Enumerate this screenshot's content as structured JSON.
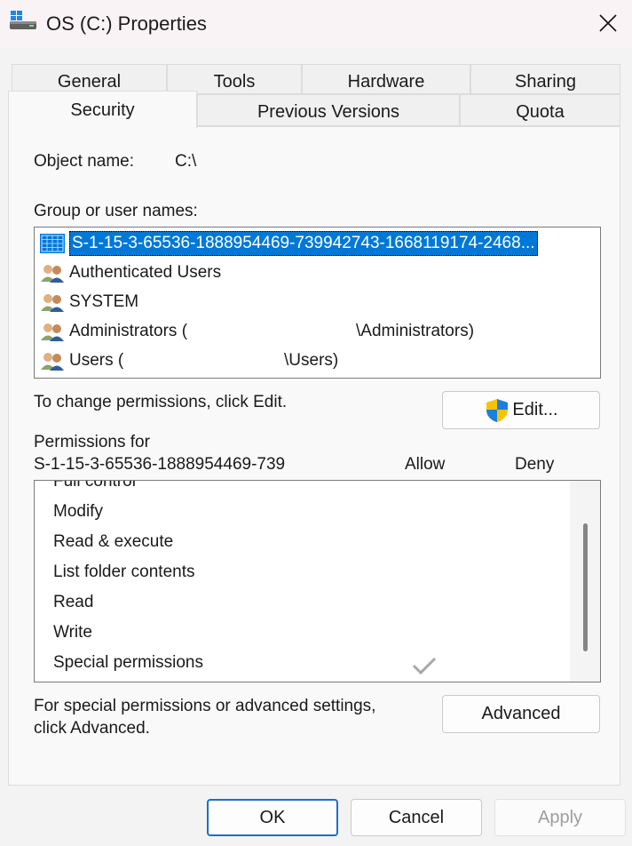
{
  "window": {
    "title": "OS (C:) Properties",
    "icon": "drive-icon",
    "close_icon": "close-icon"
  },
  "tabs_row1": [
    "General",
    "Tools",
    "Hardware",
    "Sharing"
  ],
  "tabs_row2": [
    "Security",
    "Previous Versions",
    "Quota"
  ],
  "active_tab": "Security",
  "object": {
    "label": "Object name:",
    "value": "C:\\"
  },
  "group": {
    "label": "Group or user names:",
    "users": [
      {
        "name": "S-1-15-3-65536-1888954469-739942743-1668119174-2468...",
        "icon": "package-icon",
        "selected": true
      },
      {
        "name": "Authenticated Users",
        "icon": "users-icon"
      },
      {
        "name": "SYSTEM",
        "icon": "users-icon"
      },
      {
        "name": "Administrators (",
        "suffix": "\\Administrators)",
        "icon": "users-icon"
      },
      {
        "name": "Users (",
        "suffix": "\\Users)",
        "icon": "users-icon"
      }
    ]
  },
  "change_hint": "To change permissions, click Edit.",
  "edit_button": "Edit...",
  "permissions": {
    "label_line1": "Permissions for",
    "label_line2": "S-1-15-3-65536-1888954469-739",
    "allow": "Allow",
    "deny": "Deny",
    "items": [
      "Full control",
      "Modify",
      "Read & execute",
      "List folder contents",
      "Read",
      "Write",
      "Special permissions"
    ],
    "checked_item": "Special permissions"
  },
  "advanced": {
    "hint_line1": "For special permissions or advanced settings,",
    "hint_line2": "click Advanced.",
    "button": "Advanced"
  },
  "footer": {
    "ok": "OK",
    "cancel": "Cancel",
    "apply": "Apply"
  },
  "colors": {
    "accent": "#0078d7",
    "primary_border": "#1f6fc4"
  }
}
